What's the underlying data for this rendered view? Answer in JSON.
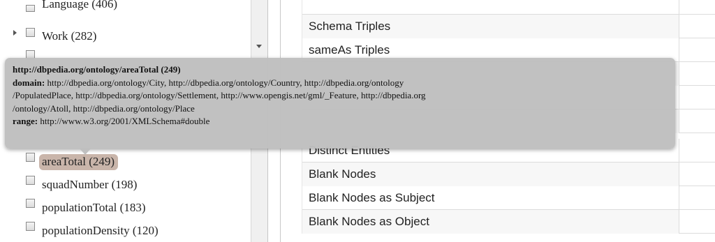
{
  "tree": {
    "items": [
      {
        "label": "Language (406)"
      },
      {
        "label": "Work (282)"
      },
      {
        "label": "areaTotal (249)"
      },
      {
        "label": "squadNumber (198)"
      },
      {
        "label": "populationTotal (183)"
      },
      {
        "label": "populationDensity (120)"
      }
    ]
  },
  "stats": {
    "rows": [
      {
        "label": "Schema Triples"
      },
      {
        "label": "sameAs Triples"
      },
      {
        "label": "Distinct Entities"
      },
      {
        "label": "Blank Nodes"
      },
      {
        "label": "Blank Nodes as Subject"
      },
      {
        "label": "Blank Nodes as Object"
      }
    ]
  },
  "tooltip": {
    "title": "http://dbpedia.org/ontology/areaTotal (249)",
    "domain_label": "domain:",
    "domain_line1": " http://dbpedia.org/ontology/City, http://dbpedia.org/ontology/Country, http://dbpedia.org/ontology",
    "domain_line2": "/PopulatedPlace, http://dbpedia.org/ontology/Settlement, http://www.opengis.net/gml/_Feature, http://dbpedia.org",
    "domain_line3": "/ontology/Atoll, http://dbpedia.org/ontology/Place",
    "range_label": "range:",
    "range_value": " http://www.w3.org/2001/XMLSchema#double"
  },
  "colors": {
    "highlight": "#c9b5aa",
    "tooltip_bg": "#bebebe"
  }
}
